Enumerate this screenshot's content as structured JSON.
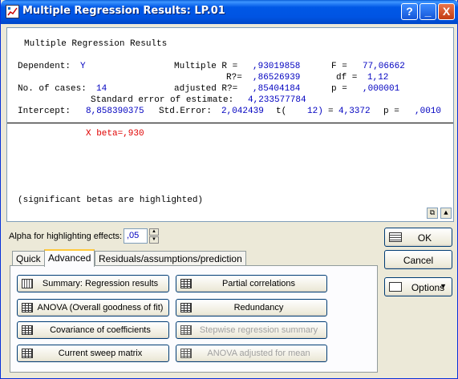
{
  "window": {
    "title": "Multiple Regression Results: LP.01",
    "help_label": "?",
    "min_label": "_",
    "close_label": "X"
  },
  "results": {
    "heading": "Multiple Regression Results",
    "dependent_label": "Dependent:",
    "dependent_value": "Y",
    "multiple_r_label": "Multiple R =",
    "multiple_r_value": ",93019858",
    "f_label": "F =",
    "f_value": "77,06662",
    "r2_label": "R?=",
    "r2_value": ",86526939",
    "df_label": "df =",
    "df_value": "1,12",
    "cases_label": "No. of cases:",
    "cases_value": "14",
    "adj_r2_label": "adjusted R?=",
    "adj_r2_value": ",85404184",
    "p_label": "p =",
    "p_value": ",000001",
    "se_label": "Standard error of estimate:",
    "se_value": "4,233577784",
    "intercept_label": "Intercept:",
    "intercept_value": "8,858390375",
    "stderr_label": "Std.Error:",
    "stderr_value": "2,042439",
    "t_label": "t(",
    "t_df": "12)",
    "t_eq": "=",
    "t_value": "4,3372",
    "p2_label": "p =",
    "p2_value": ",0010",
    "beta_line": "X beta=,930",
    "note": "(significant betas are highlighted)"
  },
  "alpha": {
    "label": "Alpha for highlighting effects:",
    "value": ",05"
  },
  "tabs": [
    {
      "label": "Quick"
    },
    {
      "label": "Advanced"
    },
    {
      "label": "Residuals/assumptions/prediction"
    }
  ],
  "panel_buttons": {
    "summary": "Summary:  Regression results",
    "partial": "Partial correlations",
    "anova": "ANOVA (Overall goodness of fit)",
    "redundancy": "Redundancy",
    "covariance": "Covariance of coefficients",
    "stepwise": "Stepwise regression summary",
    "sweep": "Current sweep matrix",
    "anova_adj": "ANOVA adjusted for mean"
  },
  "right_buttons": {
    "ok": "OK",
    "cancel": "Cancel",
    "options": "Options"
  },
  "colors": {
    "value_blue": "#0000c0",
    "highlight_red": "#e00000",
    "titlebar_blue": "#0054e3"
  }
}
